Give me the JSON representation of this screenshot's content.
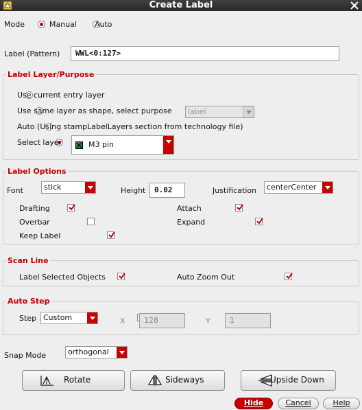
{
  "window": {
    "title": "Create Label"
  },
  "mode": {
    "label": "Mode",
    "options": [
      "Manual",
      "Auto"
    ],
    "selected": "Manual"
  },
  "label_pattern": {
    "label": "Label (Pattern)",
    "value": "WWL<0:127>"
  },
  "layer_purpose": {
    "title": "Label Layer/Purpose",
    "option_current": "Use current entry layer",
    "option_same": "Use same layer as shape, select purpose",
    "purpose_value": "label",
    "option_auto": "Auto (Using stampLabelLayers section from technology file)",
    "option_select": "Select layer",
    "layer_value": "M3 pin",
    "selected": "Select layer"
  },
  "label_options": {
    "title": "Label Options",
    "font_label": "Font",
    "font_value": "stick",
    "height_label": "Height",
    "height_value": "0.02",
    "justification_label": "Justification",
    "justification_value": "centerCenter",
    "drafting": "Drafting",
    "attach": "Attach",
    "overbar": "Overbar",
    "expand": "Expand",
    "keep_label": "Keep Label"
  },
  "scan_line": {
    "title": "Scan Line",
    "label_selected": "Label Selected Objects",
    "auto_zoom": "Auto Zoom Out"
  },
  "auto_step": {
    "title": "Auto Step",
    "step_label": "Step",
    "step_value": "Custom",
    "x_label": "X",
    "x_value": "128",
    "y_label": "Y",
    "y_value": "1"
  },
  "snap_mode": {
    "label": "Snap Mode",
    "value": "orthogonal"
  },
  "buttons": {
    "rotate": "Rotate",
    "sideways": "Sideways",
    "upside_down": "Upside Down",
    "hide": "Hide",
    "cancel": "Cancel",
    "help": "Help"
  },
  "colors": {
    "accent": "#c80000",
    "title_bar": "#333333",
    "background": "#efeeee"
  }
}
